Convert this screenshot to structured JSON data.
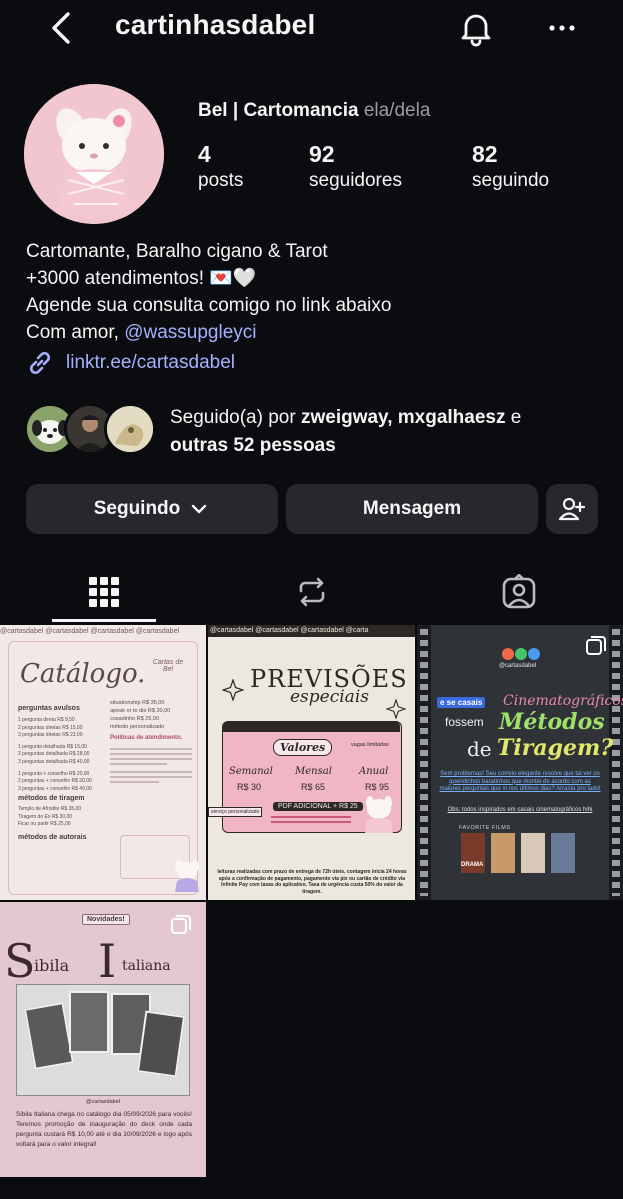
{
  "header": {
    "username": "cartinhasdabel"
  },
  "profile": {
    "name": "Bel | Cartomancia",
    "pronouns": "ela/dela",
    "stats": [
      {
        "value": "4",
        "label": "posts"
      },
      {
        "value": "92",
        "label": "seguidores"
      },
      {
        "value": "82",
        "label": "seguindo"
      }
    ],
    "bio": {
      "line1": "Cartomante, Baralho cigano & Tarot",
      "line2": "+3000 atendimentos! 💌🤍",
      "line3": "Agende sua consulta comigo no link abaixo",
      "line4_prefix": "Com amor, ",
      "line4_mention": "@wassupgleyci"
    },
    "link": "linktr.ee/cartasdabel",
    "followed_by": {
      "prefix": "Seguido(a) por ",
      "names": "zweigway, mxgalhaesz",
      "conj": " e",
      "others": "outras 52 pessoas"
    }
  },
  "actions": {
    "following_label": "Seguindo",
    "message_label": "Mensagem"
  },
  "tabs": [
    "grid-icon",
    "reels-icon",
    "tagged-icon"
  ],
  "posts": {
    "p1": {
      "strip": "@cartasdabel @cartasdabel @cartasdabel @cartasdabel",
      "title": "Catálogo.",
      "logo": "Cartas de Bel",
      "sec1": "perguntas avulsos",
      "rows1": [
        "1 pergunta direta  R$ 9,50",
        "2 perguntas diretas  R$ 15,00",
        "3 perguntas diretas  R$ 23,00",
        "1 pergunta detalhada  R$ 15,00",
        "2 perguntas detalhada  R$ 28,00",
        "3 perguntas detalhada  R$ 40,00",
        "1 pergunta + conselho  R$ 20,00",
        "2 perguntas + conselho  R$ 30,00",
        "3 perguntas + conselho  R$ 40,00"
      ],
      "col2": [
        "situationship  R$ 35,00",
        "apeak or to die  R$ 20,00",
        "cosadinho  R$ 25,00",
        "método personalizado"
      ],
      "sec2": "métodos de tiragem",
      "rows2": [
        "Templo de Afrodite  R$ 35,00",
        "Tiragem do Ex  R$ 30,00",
        "Ficar ou partir  R$ 25,00"
      ],
      "sec3": "métodos de autorais",
      "policies": "Políticas de atendimento."
    },
    "p2": {
      "strip": "@cartasdabel @cartasdabel @cartasdabel @carta",
      "title1": "PREVISÕES",
      "title2": "especiais",
      "values_label": "Valores",
      "limited": "vagas limitadas",
      "plans": [
        "Semanal",
        "Mensal",
        "Anual"
      ],
      "prices": [
        "R$ 30",
        "R$ 65",
        "R$ 95"
      ],
      "pdf": "PDF ADICIONAL + R$ 25",
      "service": "serviço personalizado",
      "footer": "leituras realizadas com prazo de entrega de 72h úteis, contagem inicia 24 horas após a confirmação de pagamento, pagamento via pix ou cartão de crédito via Infinite Pay com taxas do aplicativo. Taxa de urgência custa 50% do valor da tiragem."
    },
    "p3": {
      "handle": "@cartasdabel",
      "badge": "e se casais",
      "line1": "Cinematográficos",
      "line2a": "fossem",
      "line2b": "Métodos",
      "line3a": "de",
      "line3b": "Tiragem?",
      "body": "Sem problemas! Seu correio elegante resolve que tal ver os queridinhos baratinhos que montei de acordo com as maiores perguntas que vi nos últimos dias? Arrasta pro lado!",
      "note": "Obs: todos inspirados em casais cinematográficos hihi",
      "favorite": "FAVORITE FILMS",
      "film": "DRAMA"
    },
    "p4": {
      "badge": "Novidades!",
      "title_s": "S",
      "title_1": "ibila",
      "title_i": "I",
      "title_2": "taliana",
      "handle": "@cartasdabel",
      "body": "Sibila Italiana chega no catálogo dia 05/09/2026 para vocês! Teremos promoção de inauguração do deck onde cada pergunta custará R$ 10,00 até o dia 10/09/2026 e logo após voltará para o valor integral!"
    }
  },
  "colors": {
    "background": "#0b0c10",
    "button": "#26282e",
    "link": "#a6b0ff",
    "avatar_bg": "#f1c6cf"
  }
}
